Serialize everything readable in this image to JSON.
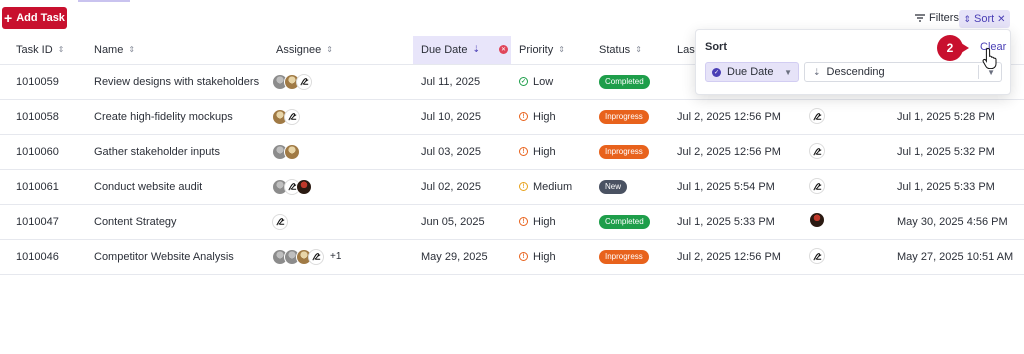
{
  "toolbar": {
    "add_task_label": "Add Task",
    "filters_label": "Filters",
    "sort_label": "Sort"
  },
  "table": {
    "columns": [
      "Task ID",
      "Name",
      "Assignee",
      "Due Date",
      "Priority",
      "Status",
      "Last"
    ],
    "rows": [
      {
        "id": "1010059",
        "name": "Review designs with stakeholders",
        "due": "Jul 11, 2025",
        "priority": "Low",
        "status": "Completed",
        "last": "",
        "updated_by": "",
        "created": ""
      },
      {
        "id": "1010058",
        "name": "Create high-fidelity mockups",
        "due": "Jul 10, 2025",
        "priority": "High",
        "status": "Inprogress",
        "last": "Jul 2, 2025 12:56 PM",
        "updated_by": "signature",
        "created": "Jul 1, 2025 5:28 PM"
      },
      {
        "id": "1010060",
        "name": "Gather stakeholder inputs",
        "due": "Jul 03, 2025",
        "priority": "High",
        "status": "Inprogress",
        "last": "Jul 2, 2025 12:56 PM",
        "updated_by": "signature",
        "created": "Jul 1, 2025 5:32 PM"
      },
      {
        "id": "1010061",
        "name": "Conduct website audit",
        "due": "Jul 02, 2025",
        "priority": "Medium",
        "status": "New",
        "last": "Jul 1, 2025 5:54 PM",
        "updated_by": "signature",
        "created": "Jul 1, 2025 5:33 PM"
      },
      {
        "id": "1010047",
        "name": "Content Strategy",
        "due": "Jun 05, 2025",
        "priority": "High",
        "status": "Completed",
        "last": "Jul 1, 2025 5:33 PM",
        "updated_by": "photo",
        "created": "May 30, 2025 4:56 PM"
      },
      {
        "id": "1010046",
        "name": "Competitor Website Analysis",
        "due": "May 29, 2025",
        "priority": "High",
        "status": "Inprogress",
        "last": "Jul 2, 2025 12:56 PM",
        "updated_by": "signature",
        "created": "May 27, 2025 10:51 AM"
      }
    ],
    "more_assignees": "+1"
  },
  "sort_panel": {
    "title": "Sort",
    "clear_label": "Clear",
    "field": "Due Date",
    "direction": "Descending"
  },
  "annotation": {
    "step": "2"
  },
  "colors": {
    "brand_red": "#c8102e",
    "accent_purple": "#4a3fb5",
    "completed": "#1e9e4a",
    "inprogress": "#e8621c",
    "new": "#4a5262",
    "priority_low": "#1e9e4a",
    "priority_high": "#e8621c",
    "priority_medium": "#e8a21c"
  }
}
